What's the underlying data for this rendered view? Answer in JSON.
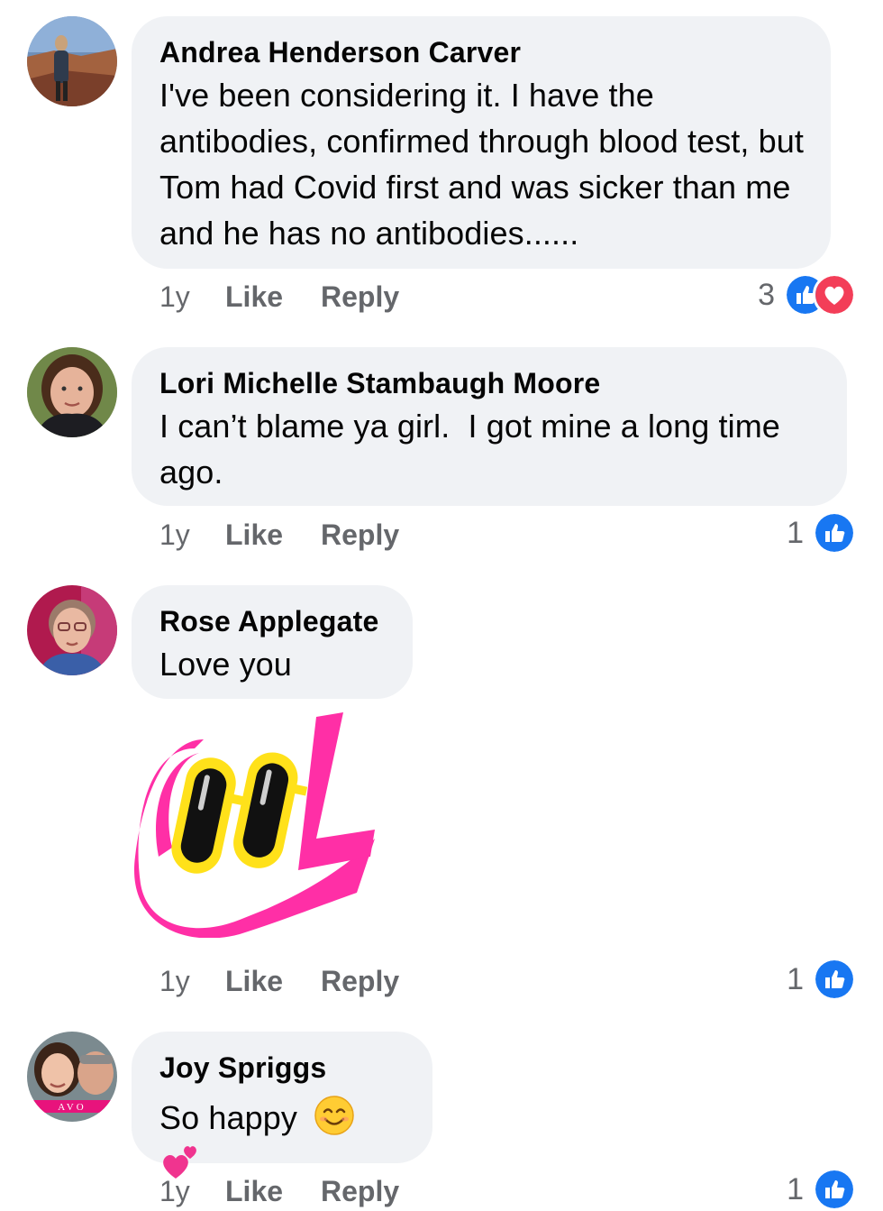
{
  "comments": [
    {
      "author": "Andrea Henderson Carver",
      "text": "I've been considering it. I have the antibodies, confirmed through blood test, but Tom had Covid first and was sicker than me and he has no antibodies......",
      "time": "1y",
      "like_label": "Like",
      "reply_label": "Reply",
      "reaction_count": "3",
      "reactions": [
        "like-icon",
        "love-icon"
      ]
    },
    {
      "author": "Lori Michelle Stambaugh Moore",
      "text": "I can’t blame ya girl.  I got mine a long time ago.",
      "time": "1y",
      "like_label": "Like",
      "reply_label": "Reply",
      "reaction_count": "1",
      "reactions": [
        "like-icon"
      ]
    },
    {
      "author": "Rose Applegate",
      "text": "Love you",
      "sticker": "cool-sunglasses-sticker",
      "time": "1y",
      "like_label": "Like",
      "reply_label": "Reply",
      "reaction_count": "1",
      "reactions": [
        "like-icon"
      ]
    },
    {
      "author": "Joy Spriggs",
      "text": "So happy",
      "emojis": [
        "smiling-face-emoji",
        "two-hearts-emoji"
      ],
      "time": "1y",
      "like_label": "Like",
      "reply_label": "Reply",
      "reaction_count": "1",
      "reactions": [
        "like-icon"
      ]
    }
  ],
  "colors": {
    "bubble": "#f0f2f5",
    "meta_text": "#65676b",
    "like_blue": "#1877f2",
    "love_red": "#f33e58",
    "sticker_pink": "#ff2fa6",
    "sticker_yellow": "#ffe11a"
  }
}
